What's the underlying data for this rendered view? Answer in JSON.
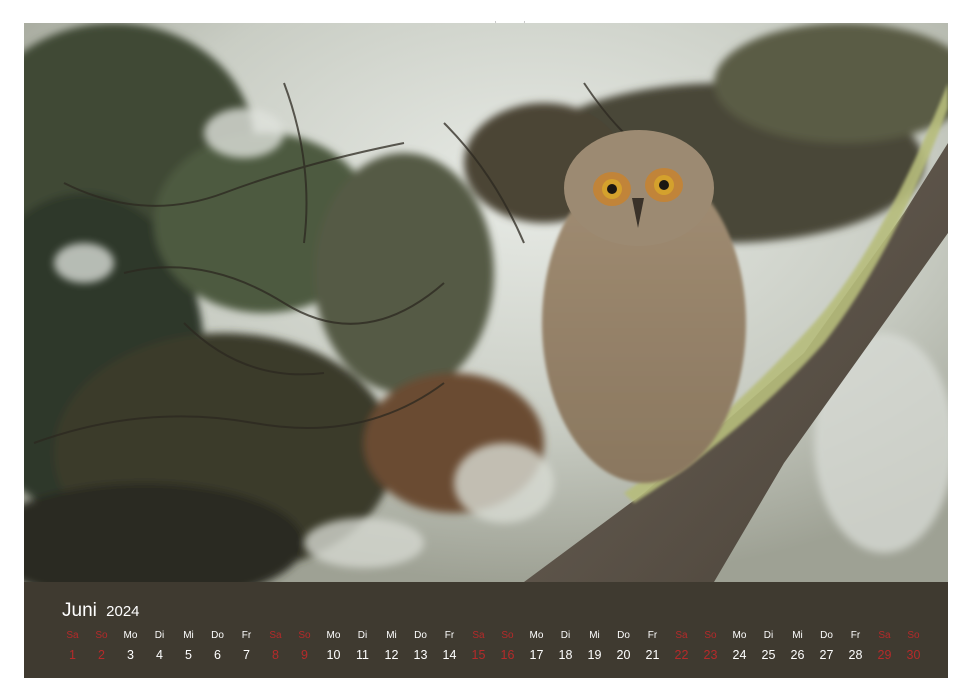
{
  "calendar": {
    "month": "Juni",
    "year": "2024",
    "weekday_names": [
      "Sa",
      "So",
      "Mo",
      "Di",
      "Mi",
      "Do",
      "Fr",
      "Sa",
      "So",
      "Mo",
      "Di",
      "Mi",
      "Do",
      "Fr",
      "Sa",
      "So",
      "Mo",
      "Di",
      "Mi",
      "Do",
      "Fr",
      "Sa",
      "So",
      "Mo",
      "Di",
      "Mi",
      "Do",
      "Fr",
      "Sa",
      "So"
    ],
    "days": [
      "1",
      "2",
      "3",
      "4",
      "5",
      "6",
      "7",
      "8",
      "9",
      "10",
      "11",
      "12",
      "13",
      "14",
      "15",
      "16",
      "17",
      "18",
      "19",
      "20",
      "21",
      "22",
      "23",
      "24",
      "25",
      "26",
      "27",
      "28",
      "29",
      "30"
    ],
    "weekend_color": "#b52a2a",
    "text_color": "#ffffff",
    "background_color": "#3f3a30"
  },
  "photo": {
    "subject": "owl-chick-icon"
  },
  "binding": {
    "dot_color": "#b9b9b9"
  }
}
